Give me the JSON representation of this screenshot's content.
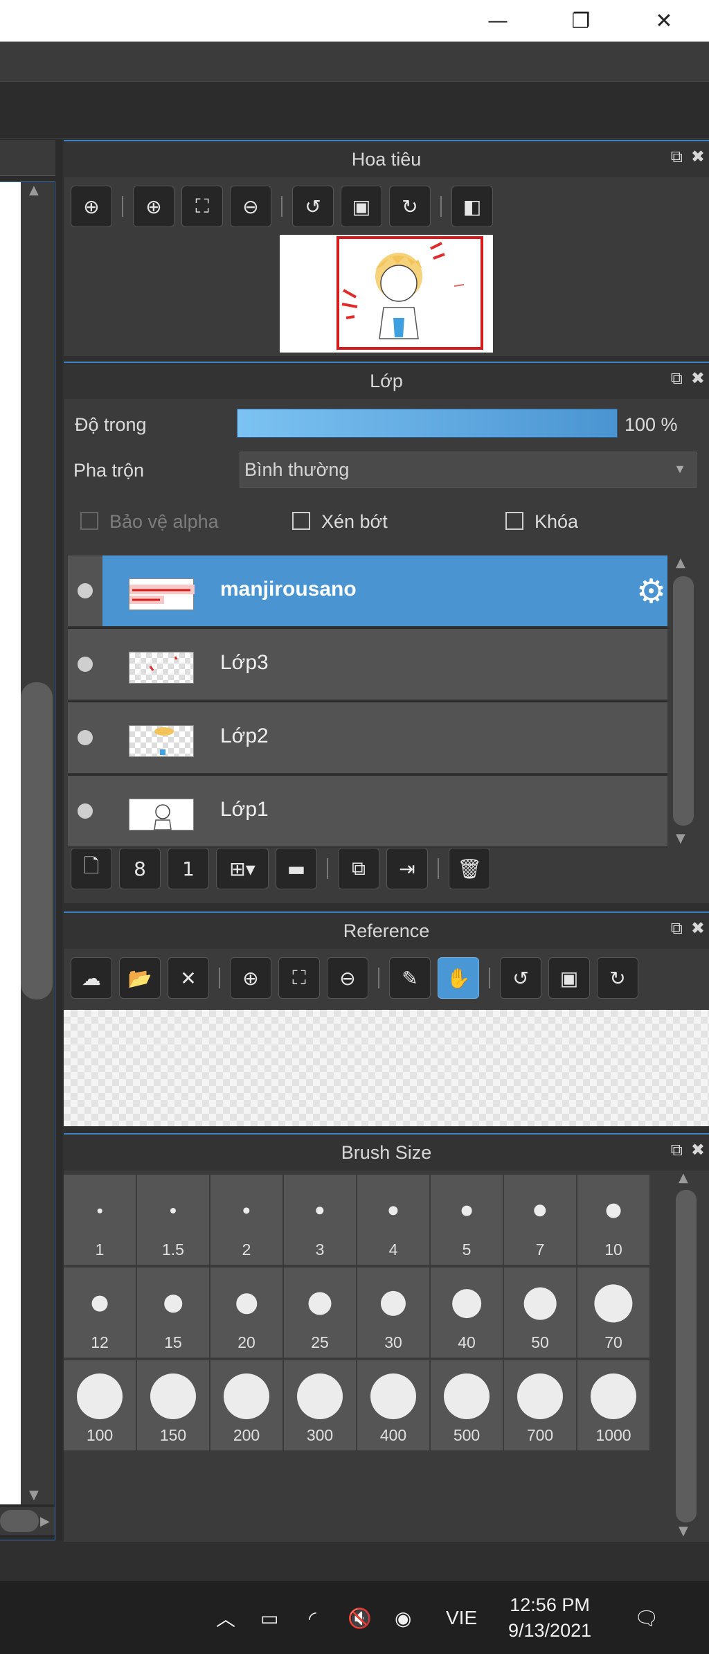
{
  "window": {
    "minimize_glyph": "—",
    "restore_glyph": "❐",
    "close_glyph": "✕"
  },
  "navigator": {
    "title": "Hoa tiêu"
  },
  "layers": {
    "title": "Lớp",
    "opacity_label": "Độ trong",
    "opacity_value": 100,
    "opacity_text": "100 %",
    "blend_label": "Pha trộn",
    "blend_value": "Bình thường",
    "protect_alpha_label": "Bảo vệ alpha",
    "clipping_label": "Xén bớt",
    "lock_label": "Khóa",
    "items": [
      {
        "name": "manjirousano",
        "selected": true
      },
      {
        "name": "Lớp3",
        "selected": false
      },
      {
        "name": "Lớp2",
        "selected": false
      },
      {
        "name": "Lớp1",
        "selected": false
      }
    ]
  },
  "reference": {
    "title": "Reference"
  },
  "brush_size": {
    "title": "Brush Size",
    "sizes": [
      "1",
      "1.5",
      "2",
      "3",
      "4",
      "5",
      "7",
      "10",
      "12",
      "15",
      "20",
      "25",
      "30",
      "40",
      "50",
      "70",
      "100",
      "150",
      "200",
      "300",
      "400",
      "500",
      "700",
      "1000"
    ]
  },
  "taskbar": {
    "language": "VIE",
    "time": "12:56 PM",
    "date": "9/13/2021"
  },
  "colors": {
    "accent": "#4a94d2",
    "panel_bg": "#3b3b3b",
    "selection_rect": "#d51b1b"
  }
}
